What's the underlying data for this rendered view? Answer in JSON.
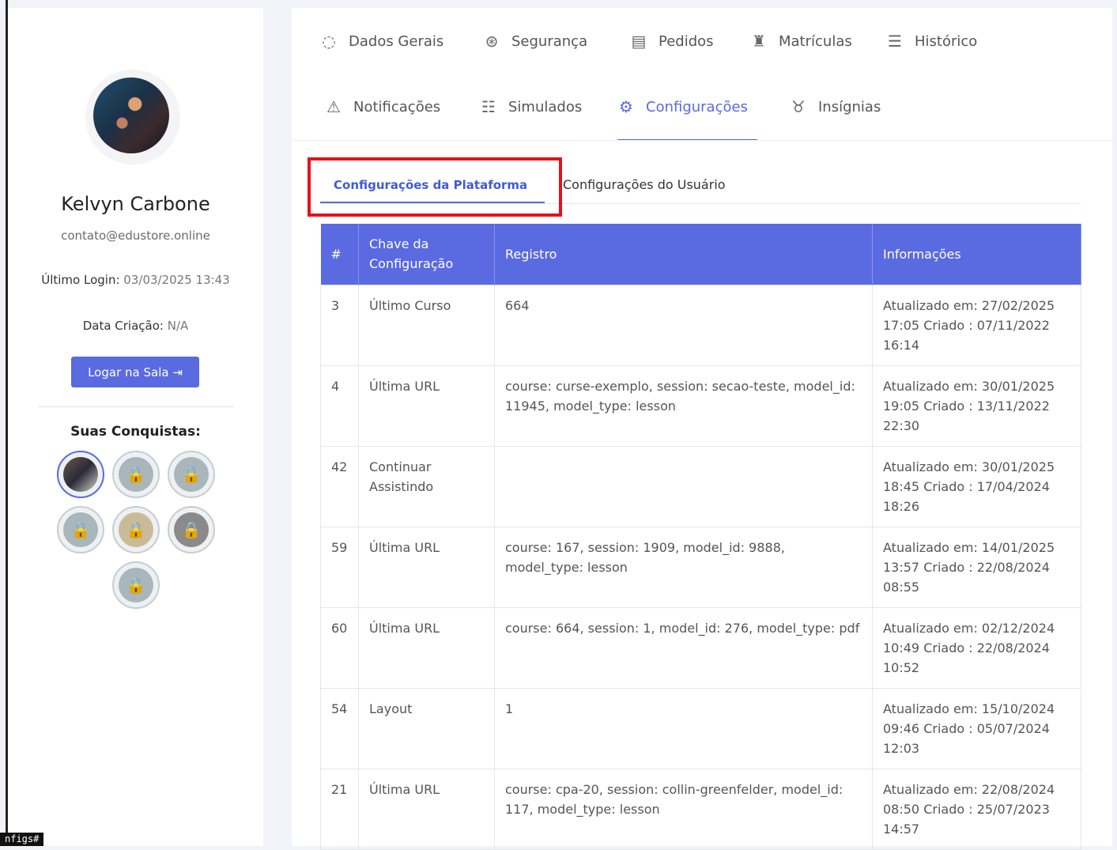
{
  "profile": {
    "name": "Kelvyn Carbone",
    "email": "contato@edustore.online",
    "last_login_label": "Último Login:",
    "last_login_value": "03/03/2025 13:43",
    "created_label": "Data Criação:",
    "created_value": "N/A",
    "login_button": "Logar na Sala ⇥",
    "achievements_title": "Suas Conquistas:",
    "badges": [
      "achievement-unlocked",
      "locked",
      "locked",
      "locked",
      "locked",
      "locked",
      "locked"
    ]
  },
  "tabs": [
    {
      "label": "Dados Gerais",
      "icon": "user-icon"
    },
    {
      "label": "Segurança",
      "icon": "lifebuoy-icon"
    },
    {
      "label": "Pedidos",
      "icon": "document-icon"
    },
    {
      "label": "Matrículas",
      "icon": "graduate-icon"
    },
    {
      "label": "Histórico",
      "icon": "list-icon"
    },
    {
      "label": "Notificações",
      "icon": "warning-icon"
    },
    {
      "label": "Simulados",
      "icon": "checklist-icon"
    },
    {
      "label": "Configurações",
      "icon": "gear-icon",
      "active": true
    },
    {
      "label": "Insígnias",
      "icon": "medal-icon"
    }
  ],
  "subtabs": {
    "platform": "Configurações da Plataforma",
    "user": "Configurações do Usuário"
  },
  "table": {
    "headers": [
      "#",
      "Chave da Configuração",
      "Registro",
      "Informações"
    ],
    "rows": [
      {
        "id": "3",
        "key": "Último Curso",
        "value": "664",
        "info": "Atualizado em: 27/02/2025 17:05 Criado : 07/11/2022 16:14"
      },
      {
        "id": "4",
        "key": "Última URL",
        "value": "course: curse-exemplo, session: secao-teste, model_id: 11945, model_type: lesson",
        "info": "Atualizado em: 30/01/2025 19:05 Criado : 13/11/2022 22:30"
      },
      {
        "id": "42",
        "key": "Continuar Assistindo",
        "value": "",
        "info": "Atualizado em: 30/01/2025 18:45 Criado : 17/04/2024 18:26"
      },
      {
        "id": "59",
        "key": "Última URL",
        "value": "course: 167, session: 1909, model_id: 9888, model_type: lesson",
        "info": "Atualizado em: 14/01/2025 13:57 Criado : 22/08/2024 08:55"
      },
      {
        "id": "60",
        "key": "Última URL",
        "value": "course: 664, session: 1, model_id: 276, model_type: pdf",
        "info": "Atualizado em: 02/12/2024 10:49 Criado : 22/08/2024 10:52"
      },
      {
        "id": "54",
        "key": "Layout",
        "value": "1",
        "info": "Atualizado em: 15/10/2024 09:46 Criado : 05/07/2024 12:03"
      },
      {
        "id": "21",
        "key": "Última URL",
        "value": "course: cpa-20, session: collin-greenfelder, model_id: 117, model_type: lesson",
        "info": "Atualizado em: 22/08/2024 08:50 Criado : 25/07/2023 14:57"
      }
    ]
  },
  "status_tag": "nfigs#",
  "colors": {
    "accent": "#5a6ae0",
    "highlight": "#e4121b"
  }
}
